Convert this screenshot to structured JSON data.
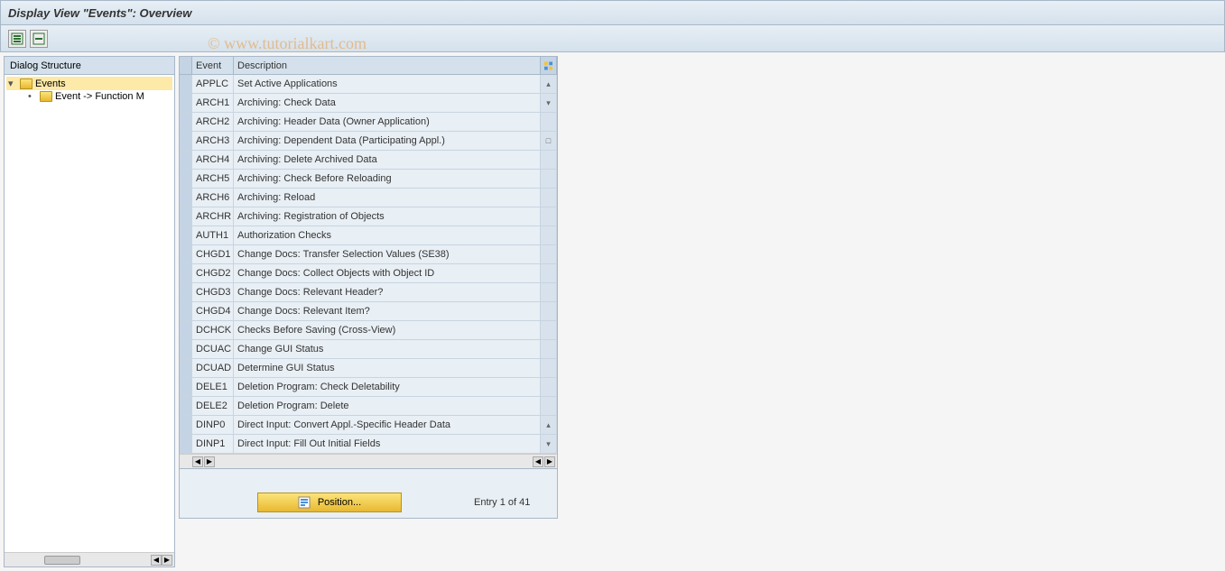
{
  "titlebar": {
    "title": "Display View \"Events\": Overview"
  },
  "watermark": "© www.tutorialkart.com",
  "tree": {
    "header": "Dialog Structure",
    "items": [
      {
        "label": "Events",
        "level": 0,
        "open": true,
        "selected": true
      },
      {
        "label": "Event -> Function M",
        "level": 1,
        "open": false,
        "selected": false
      }
    ]
  },
  "table": {
    "columns": {
      "event": "Event",
      "description": "Description"
    },
    "rows": [
      {
        "event": "APPLC",
        "description": "Set Active Applications"
      },
      {
        "event": "ARCH1",
        "description": "Archiving: Check Data"
      },
      {
        "event": "ARCH2",
        "description": "Archiving: Header Data (Owner Application)"
      },
      {
        "event": "ARCH3",
        "description": "Archiving: Dependent Data (Participating Appl.)"
      },
      {
        "event": "ARCH4",
        "description": "Archiving: Delete Archived Data"
      },
      {
        "event": "ARCH5",
        "description": "Archiving: Check Before Reloading"
      },
      {
        "event": "ARCH6",
        "description": "Archiving: Reload"
      },
      {
        "event": "ARCHR",
        "description": "Archiving: Registration of Objects"
      },
      {
        "event": "AUTH1",
        "description": "Authorization Checks"
      },
      {
        "event": "CHGD1",
        "description": "Change Docs: Transfer Selection Values (SE38)"
      },
      {
        "event": "CHGD2",
        "description": "Change Docs: Collect Objects with Object ID"
      },
      {
        "event": "CHGD3",
        "description": "Change Docs: Relevant Header?"
      },
      {
        "event": "CHGD4",
        "description": "Change Docs: Relevant Item?"
      },
      {
        "event": "DCHCK",
        "description": "Checks Before Saving (Cross-View)"
      },
      {
        "event": "DCUAC",
        "description": "Change GUI Status"
      },
      {
        "event": "DCUAD",
        "description": "Determine GUI Status"
      },
      {
        "event": "DELE1",
        "description": "Deletion Program: Check Deletability"
      },
      {
        "event": "DELE2",
        "description": "Deletion Program: Delete"
      },
      {
        "event": "DINP0",
        "description": "Direct Input: Convert Appl.-Specific Header Data"
      },
      {
        "event": "DINP1",
        "description": "Direct Input: Fill Out Initial Fields"
      }
    ]
  },
  "footer": {
    "position_label": "Position...",
    "entry_text": "Entry 1 of 41"
  }
}
